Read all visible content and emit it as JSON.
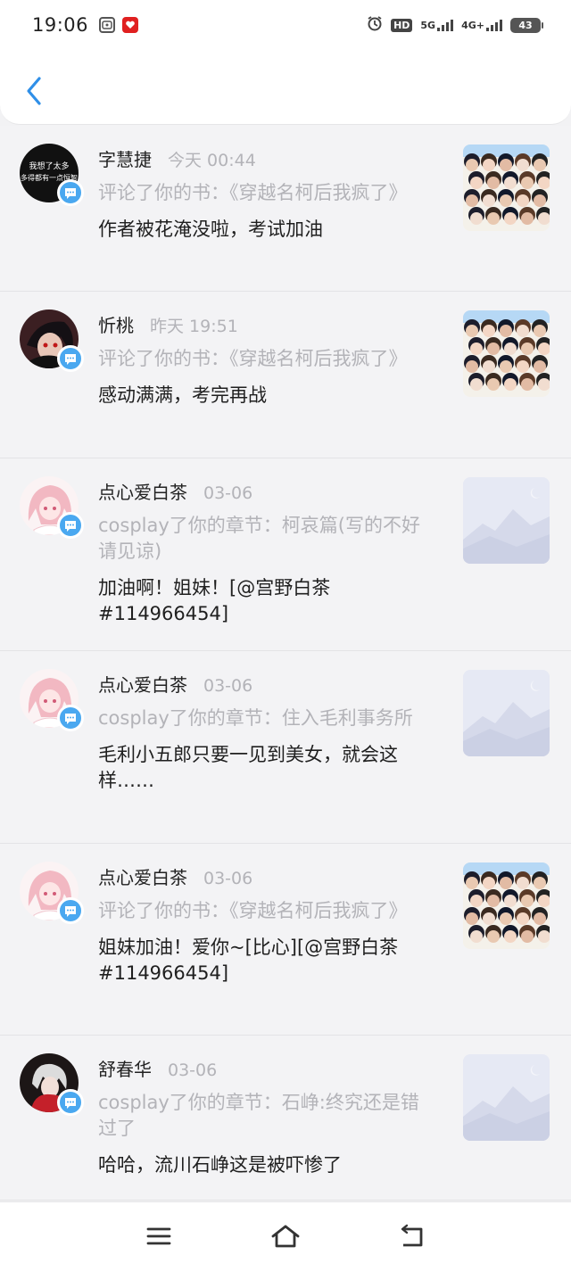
{
  "status_bar": {
    "time": "19:06",
    "hd_label": "HD",
    "network_5g": "5G",
    "network_4g": "4G+",
    "battery": "43"
  },
  "header": {
    "back_icon": "chevron-left-icon"
  },
  "notifications": [
    {
      "user": "字慧捷",
      "time": "今天 00:44",
      "action": "评论了你的书：《穿越名柯后我疯了》",
      "comment": "作者被花淹没啦，考试加油",
      "thumb_type": "cover",
      "avatar_style": "dark-text",
      "avatar_text_1": "我想了太多",
      "avatar_text_2": "多得都有一点恒智"
    },
    {
      "user": "忻桃",
      "time": "昨天 19:51",
      "action": "评论了你的书：《穿越名柯后我疯了》",
      "comment": "感动满满，考完再战",
      "thumb_type": "cover",
      "avatar_style": "anime-red"
    },
    {
      "user": "点心爱白茶",
      "time": "03-06",
      "action": "cosplay了你的章节：柯哀篇(写的不好请见谅)",
      "comment": "加油啊！姐妹！[@宫野白茶#114966454]",
      "thumb_type": "placeholder",
      "avatar_style": "anime-pink"
    },
    {
      "user": "点心爱白茶",
      "time": "03-06",
      "action": "cosplay了你的章节：住入毛利事务所",
      "comment": "毛利小五郎只要一见到美女，就会这样……",
      "thumb_type": "placeholder",
      "avatar_style": "anime-pink"
    },
    {
      "user": "点心爱白茶",
      "time": "03-06",
      "action": "评论了你的书：《穿越名柯后我疯了》",
      "comment": "姐妹加油！爱你~[比心][@宫野白茶#114966454]",
      "thumb_type": "cover",
      "avatar_style": "anime-pink"
    },
    {
      "user": "舒春华",
      "time": "03-06",
      "action": "cosplay了你的章节：石峥:终究还是错过了",
      "comment": "哈哈，流川石峥这是被吓惨了",
      "thumb_type": "placeholder",
      "avatar_style": "anime-dark"
    }
  ],
  "nav_bar": {
    "menu_icon": "menu-icon",
    "home_icon": "home-icon",
    "back_icon": "back-arrow-icon"
  },
  "colors": {
    "accent": "#2f8fe8",
    "badge": "#4aa8f0",
    "muted_text": "#b3b3b8",
    "background": "#f3f3f5"
  }
}
